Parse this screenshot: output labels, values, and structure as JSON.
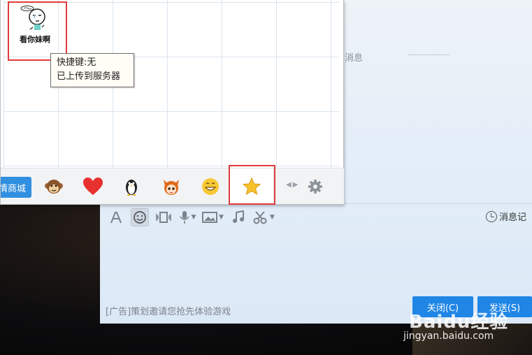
{
  "popup": {
    "sticker_caption": "看你妹啊",
    "tooltip_line1": "快捷键:无",
    "tooltip_line2": "已上传到服务器",
    "mall_label": "情商城",
    "tabs": [
      "monkey-emoji",
      "heart-emoji",
      "penguin-emoji",
      "fox-girl-emoji",
      "grin-emoji",
      "star-favorites"
    ]
  },
  "chat": {
    "top_hint": "消息",
    "history_label": "消息记",
    "ad_text": "[广告]策划邀请您抢先体验游戏",
    "close_label": "关闭(C)",
    "send_label": "发送(S)"
  },
  "watermark": {
    "logo": "Baidu经验",
    "url": "jingyan.baidu.com"
  },
  "colors": {
    "accent_blue": "#1f86e6",
    "highlight_red": "#e03b3b"
  }
}
